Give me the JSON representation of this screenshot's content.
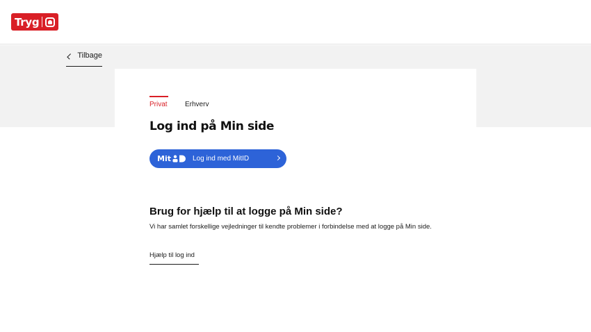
{
  "header": {
    "logo_text": "Tryg"
  },
  "nav": {
    "back_label": "Tilbage"
  },
  "tabs": [
    {
      "label": "Privat",
      "active": true
    },
    {
      "label": "Erhverv",
      "active": false
    }
  ],
  "login": {
    "title": "Log ind på Min side",
    "mitid_logo": "Mit",
    "mitid_label": "Log ind med MitID"
  },
  "help": {
    "title": "Brug for hjælp til at logge på Min side?",
    "description": "Vi har samlet forskellige vejledninger til kendte problemer i forbindelse med at logge på Min side.",
    "link_label": "Hjælp til log ind"
  },
  "colors": {
    "brand_red": "#d91f26",
    "mitid_blue": "#2d63d8",
    "band_grey": "#f2f2f2"
  },
  "icons": {
    "back": "chevron-left-icon",
    "mitid": "mitid-icon",
    "arrow": "chevron-right-icon",
    "logo": "tryg-logo-icon"
  }
}
